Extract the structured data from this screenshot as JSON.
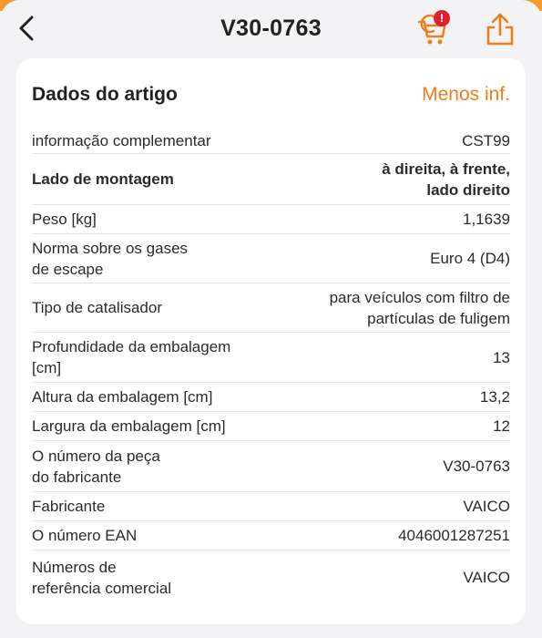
{
  "header": {
    "title": "V30-0763",
    "cart_badge": "!"
  },
  "card": {
    "title": "Dados do artigo",
    "toggle_label": "Menos inf."
  },
  "rows": [
    {
      "key": "informação complementar",
      "value": "CST99"
    },
    {
      "key": "Lado de montagem",
      "value": "à direita, à frente,\nlado direito"
    },
    {
      "key": "Peso [kg]",
      "value": "1,1639"
    },
    {
      "key": "Norma sobre os gases\nde escape",
      "value": "Euro 4 (D4)"
    },
    {
      "key": "Tipo de catalisador",
      "value": "para veículos com filtro de\npartículas de fuligem"
    },
    {
      "key": "Profundidade da embalagem\n[cm]",
      "value": "13"
    },
    {
      "key": "Altura da embalagem [cm]",
      "value": "13,2"
    },
    {
      "key": "Largura da embalagem [cm]",
      "value": "12"
    },
    {
      "key": "O número da peça\ndo fabricante",
      "value": "V30-0763"
    },
    {
      "key": "Fabricante",
      "value": "VAICO"
    },
    {
      "key": "O número EAN",
      "value": "4046001287251"
    },
    {
      "key": "Números de\nreferência comercial",
      "value": "VAICO"
    }
  ],
  "colors": {
    "accent": "#ef7d1a",
    "badge": "#e0202c"
  },
  "icons": [
    "chevron-left-icon",
    "cart-icon",
    "share-icon"
  ]
}
